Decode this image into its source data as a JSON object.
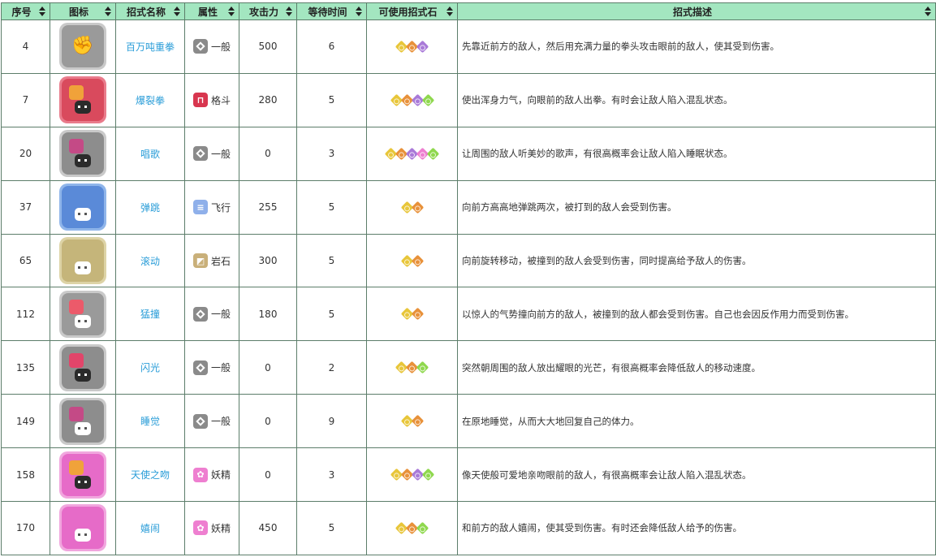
{
  "headers": {
    "idx": "序号",
    "icon": "图标",
    "name": "招式名称",
    "attr": "属性",
    "atk": "攻击力",
    "wait": "等待时间",
    "stones": "可使用招式石",
    "desc": "招式描述"
  },
  "colors": {
    "header_bg": "#a3e6c0",
    "border": "#5c7d6a",
    "link": "#2a9dd8",
    "stone_yellow": "#e8c63a",
    "stone_orange": "#e8913a",
    "stone_purple": "#a97ad8",
    "stone_pink": "#ee7fd0",
    "stone_green": "#8fd84e"
  },
  "rows": [
    {
      "idx": "4",
      "icon": "fist-icon",
      "name": "百万吨重拳",
      "attr": "一般",
      "attr_icon": "normal-type-icon",
      "atk": "500",
      "wait": "6",
      "stones": [
        "yellow",
        "orange",
        "purple"
      ],
      "desc": "先靠近前方的敌人，然后用充满力量的拳头攻击眼前的敌人，使其受到伤害。"
    },
    {
      "idx": "7",
      "icon": "burst-punch-icon",
      "name": "爆裂拳",
      "attr": "格斗",
      "attr_icon": "fighting-type-icon",
      "atk": "280",
      "wait": "5",
      "stones": [
        "yellow",
        "orange",
        "purple",
        "green"
      ],
      "desc": "使出浑身力气，向眼前的敌人出拳。有时会让敌人陷入混乱状态。"
    },
    {
      "idx": "20",
      "icon": "sing-icon",
      "name": "唱歌",
      "attr": "一般",
      "attr_icon": "normal-type-icon",
      "atk": "0",
      "wait": "3",
      "stones": [
        "yellow",
        "orange",
        "purple",
        "pink",
        "green"
      ],
      "desc": "让周围的敌人听美妙的歌声，有很高概率会让敌人陷入睡眠状态。"
    },
    {
      "idx": "37",
      "icon": "bounce-icon",
      "name": "弹跳",
      "attr": "飞行",
      "attr_icon": "flying-type-icon",
      "atk": "255",
      "wait": "5",
      "stones": [
        "yellow",
        "orange"
      ],
      "desc": "向前方高高地弹跳两次，被打到的敌人会受到伤害。"
    },
    {
      "idx": "65",
      "icon": "rollout-icon",
      "name": "滚动",
      "attr": "岩石",
      "attr_icon": "rock-type-icon",
      "atk": "300",
      "wait": "5",
      "stones": [
        "yellow",
        "orange"
      ],
      "desc": "向前旋转移动，被撞到的敌人会受到伤害，同时提高给予敌人的伤害。"
    },
    {
      "idx": "112",
      "icon": "take-down-icon",
      "name": "猛撞",
      "attr": "一般",
      "attr_icon": "normal-type-icon",
      "atk": "180",
      "wait": "5",
      "stones": [
        "yellow",
        "orange"
      ],
      "desc": "以惊人的气势撞向前方的敌人，被撞到的敌人都会受到伤害。自己也会因反作用力而受到伤害。"
    },
    {
      "idx": "135",
      "icon": "flash-icon",
      "name": "闪光",
      "attr": "一般",
      "attr_icon": "normal-type-icon",
      "atk": "0",
      "wait": "2",
      "stones": [
        "yellow",
        "orange",
        "green"
      ],
      "desc": "突然朝周围的敌人放出耀眼的光芒，有很高概率会降低敌人的移动速度。"
    },
    {
      "idx": "149",
      "icon": "rest-icon",
      "name": "睡觉",
      "attr": "一般",
      "attr_icon": "normal-type-icon",
      "atk": "0",
      "wait": "9",
      "stones": [
        "yellow",
        "orange"
      ],
      "desc": "在原地睡觉，从而大大地回复自己的体力。"
    },
    {
      "idx": "158",
      "icon": "sweet-kiss-icon",
      "name": "天使之吻",
      "attr": "妖精",
      "attr_icon": "fairy-type-icon",
      "atk": "0",
      "wait": "3",
      "stones": [
        "yellow",
        "orange",
        "purple",
        "green"
      ],
      "desc": "像天使般可爱地亲吻眼前的敌人，有很高概率会让敌人陷入混乱状态。"
    },
    {
      "idx": "170",
      "icon": "play-rough-icon",
      "name": "嬉闹",
      "attr": "妖精",
      "attr_icon": "fairy-type-icon",
      "atk": "450",
      "wait": "5",
      "stones": [
        "yellow",
        "orange",
        "green"
      ],
      "desc": "和前方的敌人嬉闹，使其受到伤害。有时还会降低敌人给予的伤害。"
    }
  ]
}
